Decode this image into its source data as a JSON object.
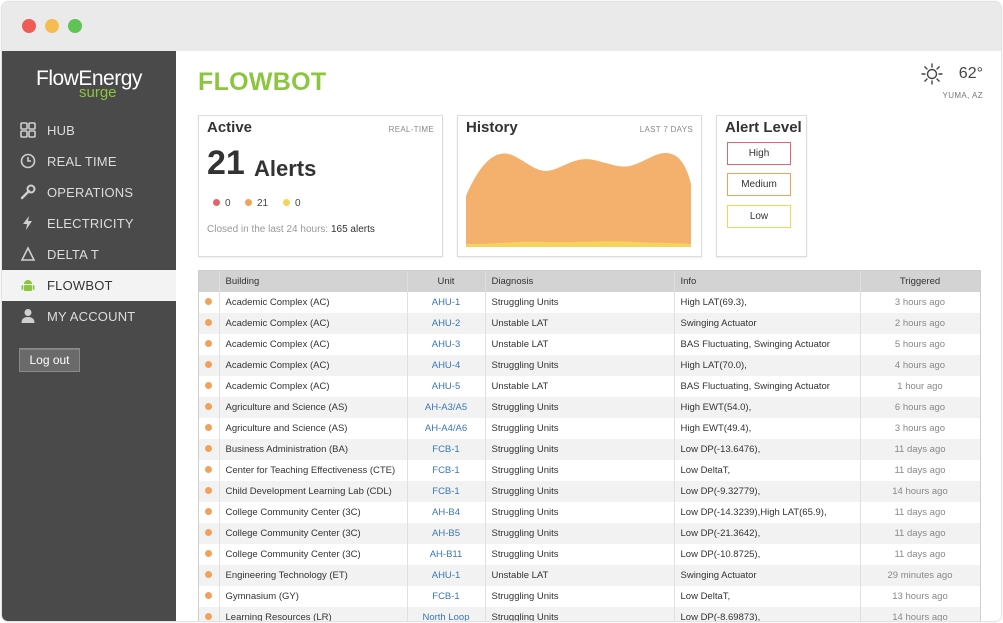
{
  "app": {
    "logo_main": "FlowEnergy",
    "logo_sub": "surge"
  },
  "sidebar": {
    "items": [
      {
        "label": "HUB",
        "icon": "grid-icon"
      },
      {
        "label": "REAL TIME",
        "icon": "clock-icon"
      },
      {
        "label": "OPERATIONS",
        "icon": "wrench-icon"
      },
      {
        "label": "ELECTRICITY",
        "icon": "lightning-icon"
      },
      {
        "label": "DELTA T",
        "icon": "delta-icon"
      },
      {
        "label": "FLOWBOT",
        "icon": "android-icon",
        "active": true
      },
      {
        "label": "MY ACCOUNT",
        "icon": "user-icon"
      }
    ],
    "logout_label": "Log out"
  },
  "header": {
    "title": "FLOWBOT",
    "weather_temp": "62°",
    "weather_location": "YUMA, AZ",
    "weather_icon": "sun-icon"
  },
  "active_card": {
    "title": "Active",
    "subtitle": "REAL-TIME",
    "count": "21",
    "count_label": "Alerts",
    "high_count": "0",
    "medium_count": "21",
    "low_count": "0",
    "closed_text": "Closed in the last 24 hours:",
    "closed_value": "165 alerts"
  },
  "history_card": {
    "title": "History",
    "subtitle": "LAST 7 DAYS"
  },
  "alert_card": {
    "title": "Alert Level",
    "levels": [
      "High",
      "Medium",
      "Low"
    ]
  },
  "colors": {
    "accent": "#8cc63f",
    "high": "#e4646c",
    "medium": "#f0a25a",
    "low": "#f6d35a",
    "sidebar_bg": "#4a4a4a",
    "link": "#3a76b5"
  },
  "table": {
    "headers": [
      "",
      "Building",
      "Unit",
      "Diagnosis",
      "Info",
      "Triggered"
    ],
    "rows": [
      {
        "building": "Academic Complex (AC)",
        "unit": "AHU-1",
        "diagnosis": "Struggling Units",
        "info": "High LAT(69.3),",
        "triggered": "3 hours ago"
      },
      {
        "building": "Academic Complex (AC)",
        "unit": "AHU-2",
        "diagnosis": "Unstable LAT",
        "info": "Swinging Actuator",
        "triggered": "2 hours ago"
      },
      {
        "building": "Academic Complex (AC)",
        "unit": "AHU-3",
        "diagnosis": "Unstable LAT",
        "info": "BAS Fluctuating, Swinging Actuator",
        "triggered": "5 hours ago"
      },
      {
        "building": "Academic Complex (AC)",
        "unit": "AHU-4",
        "diagnosis": "Struggling Units",
        "info": "High LAT(70.0),",
        "triggered": "4 hours ago"
      },
      {
        "building": "Academic Complex (AC)",
        "unit": "AHU-5",
        "diagnosis": "Unstable LAT",
        "info": "BAS Fluctuating, Swinging Actuator",
        "triggered": "1 hour ago"
      },
      {
        "building": "Agriculture and Science (AS)",
        "unit": "AH-A3/A5",
        "diagnosis": "Struggling Units",
        "info": "High EWT(54.0),",
        "triggered": "6 hours ago"
      },
      {
        "building": "Agriculture and Science (AS)",
        "unit": "AH-A4/A6",
        "diagnosis": "Struggling Units",
        "info": "High EWT(49.4),",
        "triggered": "3 hours ago"
      },
      {
        "building": "Business Administration (BA)",
        "unit": "FCB-1",
        "diagnosis": "Struggling Units",
        "info": "Low DP(-13.6476),",
        "triggered": "11 days ago"
      },
      {
        "building": "Center for Teaching Effectiveness (CTE)",
        "unit": "FCB-1",
        "diagnosis": "Struggling Units",
        "info": "Low DeltaT,",
        "triggered": "11 days ago"
      },
      {
        "building": "Child Development Learning Lab (CDL)",
        "unit": "FCB-1",
        "diagnosis": "Struggling Units",
        "info": "Low DP(-9.32779),",
        "triggered": "14 hours ago"
      },
      {
        "building": "College Community Center (3C)",
        "unit": "AH-B4",
        "diagnosis": "Struggling Units",
        "info": "Low DP(-14.3239),High LAT(65.9),",
        "triggered": "11 days ago"
      },
      {
        "building": "College Community Center (3C)",
        "unit": "AH-B5",
        "diagnosis": "Struggling Units",
        "info": "Low DP(-21.3642),",
        "triggered": "11 days ago"
      },
      {
        "building": "College Community Center (3C)",
        "unit": "AH-B11",
        "diagnosis": "Struggling Units",
        "info": "Low DP(-10.8725),",
        "triggered": "11 days ago"
      },
      {
        "building": "Engineering Technology (ET)",
        "unit": "AHU-1",
        "diagnosis": "Unstable LAT",
        "info": "Swinging Actuator",
        "triggered": "29 minutes ago"
      },
      {
        "building": "Gymnasium (GY)",
        "unit": "FCB-1",
        "diagnosis": "Struggling Units",
        "info": "Low DeltaT,",
        "triggered": "13 hours ago"
      },
      {
        "building": "Learning Resources (LR)",
        "unit": "North Loop",
        "diagnosis": "Struggling Units",
        "info": "Low DP(-8.69873),",
        "triggered": "14 hours ago"
      }
    ]
  }
}
